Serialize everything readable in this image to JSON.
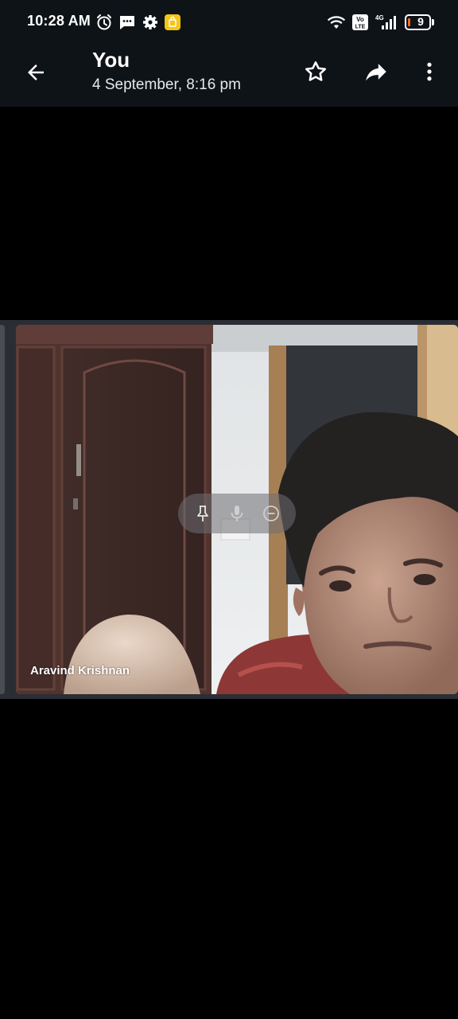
{
  "status_bar": {
    "time": "10:28 AM",
    "left_icons": [
      "alarm-icon",
      "message-icon",
      "settings-icon",
      "notification-app-icon"
    ],
    "right_icons": [
      "wifi-icon",
      "volte-icon",
      "signal-4g-icon",
      "battery-icon"
    ],
    "volte_label": "Vo LTE",
    "network_label": "4G",
    "battery_level": "9"
  },
  "app_bar": {
    "title": "You",
    "subtitle": "4 September, 8:16 pm",
    "actions": [
      "star-icon",
      "forward-icon",
      "more-vert-icon"
    ]
  },
  "media": {
    "participant_name": "Aravind Krishnan",
    "tile_controls": [
      "pin-icon",
      "mic-icon",
      "remove-icon"
    ]
  },
  "colors": {
    "background": "#000000",
    "bar_background": "#0e1318",
    "notification_badge": "#f5c518",
    "battery_accent": "#ff6a1f"
  }
}
